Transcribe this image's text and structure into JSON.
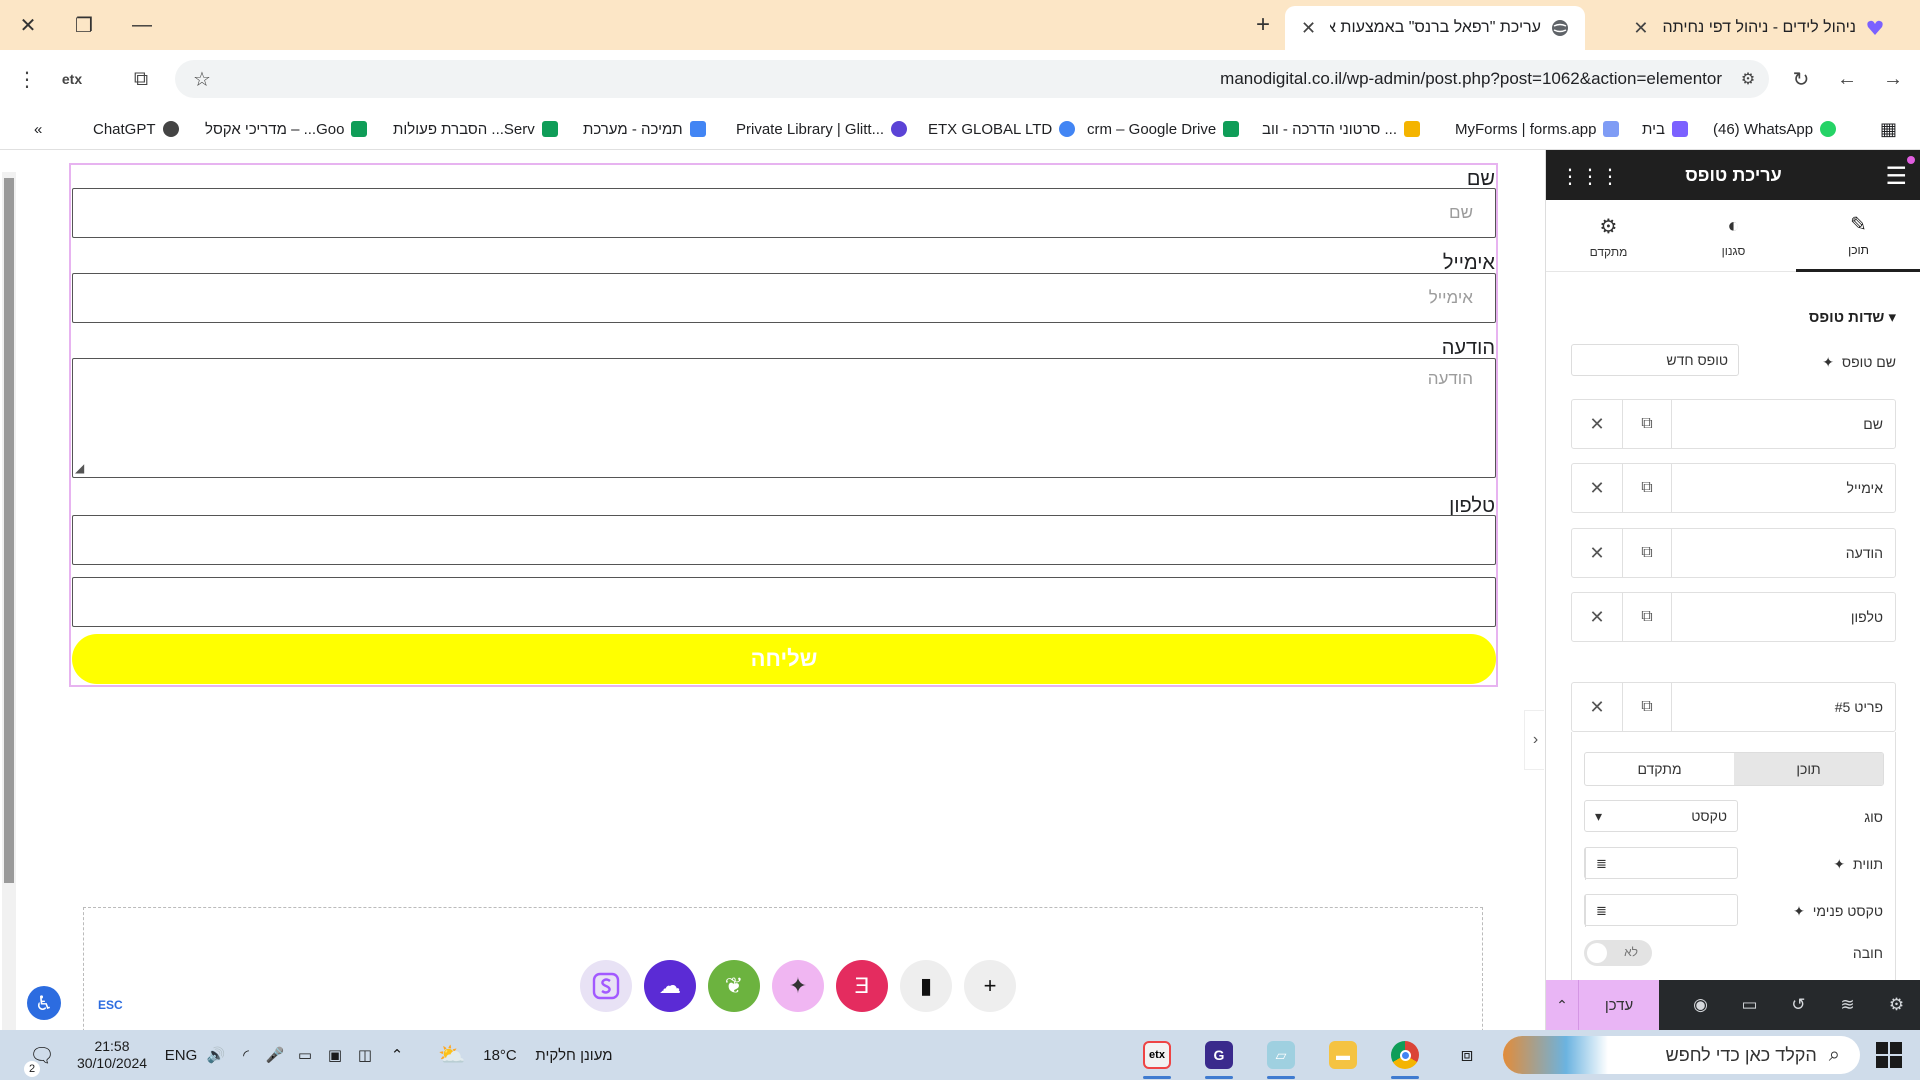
{
  "browser": {
    "tabs": [
      {
        "title": "ניהול לידים - ניהול דפי נחיתה",
        "active": false
      },
      {
        "title": "עריכת \"רפאל ברנס\" באמצעות א",
        "active": true
      }
    ],
    "url": "manodigital.co.il/wp-admin/post.php?post=1062&action=elementor",
    "bookmarks": [
      {
        "label": "(46) WhatsApp",
        "color": "#25d366"
      },
      {
        "label": "בית",
        "color": "#7b61ff"
      },
      {
        "label": "MyForms | forms.app",
        "color": "#7f9cf5"
      },
      {
        "label": "סרטוני הדרכה - ווב ...",
        "color": "#f4b400"
      },
      {
        "label": "crm – Google Drive",
        "color": "#0f9d58"
      },
      {
        "label": "ETX GLOBAL LTD",
        "color": "#4285f4"
      },
      {
        "label": "Private Library | Glitt...",
        "color": "#5b43d6"
      },
      {
        "label": "תמיכה - מערכת",
        "color": "#4285f4"
      },
      {
        "label": "הסברת פעולות ...Serv",
        "color": "#0f9d58"
      },
      {
        "label": "מדריכי אקסל – ...Goo",
        "color": "#0f9d58"
      },
      {
        "label": "ChatGPT",
        "color": "#444444"
      }
    ]
  },
  "form": {
    "fields": [
      {
        "label": "שם",
        "placeholder": "שם",
        "type": "text"
      },
      {
        "label": "אימייל",
        "placeholder": "אימייל",
        "type": "text"
      },
      {
        "label": "הודעה",
        "placeholder": "הודעה",
        "type": "textarea"
      },
      {
        "label": "טלפון",
        "placeholder": "",
        "type": "text"
      },
      {
        "label": "",
        "placeholder": "",
        "type": "text"
      }
    ],
    "submit_label": "שליחה",
    "submit_color": "#ffff00"
  },
  "canvas": {
    "esc_hint": "ESC",
    "add_icons": [
      "s-logo-icon",
      "cloud-icon",
      "leaf-icon",
      "ai-sparkle-icon",
      "elementor-kit-icon",
      "folder-icon",
      "plus-icon"
    ]
  },
  "panel": {
    "title": "עריכת טופס",
    "tabs": [
      {
        "label": "תוכן",
        "icon": "pencil-icon",
        "active": true
      },
      {
        "label": "סגנון",
        "icon": "half-circle-icon",
        "active": false
      },
      {
        "label": "מתקדם",
        "icon": "gear-icon",
        "active": false
      }
    ],
    "section_title": "שדות טופס",
    "form_name_label": "שם טופס",
    "form_name_value": "טופס חדש",
    "repeater_items": [
      "שם",
      "אימייל",
      "הודעה",
      "טלפון",
      "פריט #5"
    ],
    "item_tabs": [
      "תוכן",
      "מתקדם"
    ],
    "type_label": "סוג",
    "type_value": "טקסט",
    "label_label": "תווית",
    "placeholder_label": "טקסט פנימי",
    "required_label": "חובה",
    "required_value": "לא",
    "update_label": "עדכן",
    "accent": "#e9b5f5"
  },
  "taskbar": {
    "search_placeholder": "הקלד כאן כדי לחפש",
    "weather_text": "מעונן חלקית",
    "temperature": "18°C",
    "language": "ENG",
    "time": "21:58",
    "date": "30/10/2024",
    "notification_count": "2"
  }
}
